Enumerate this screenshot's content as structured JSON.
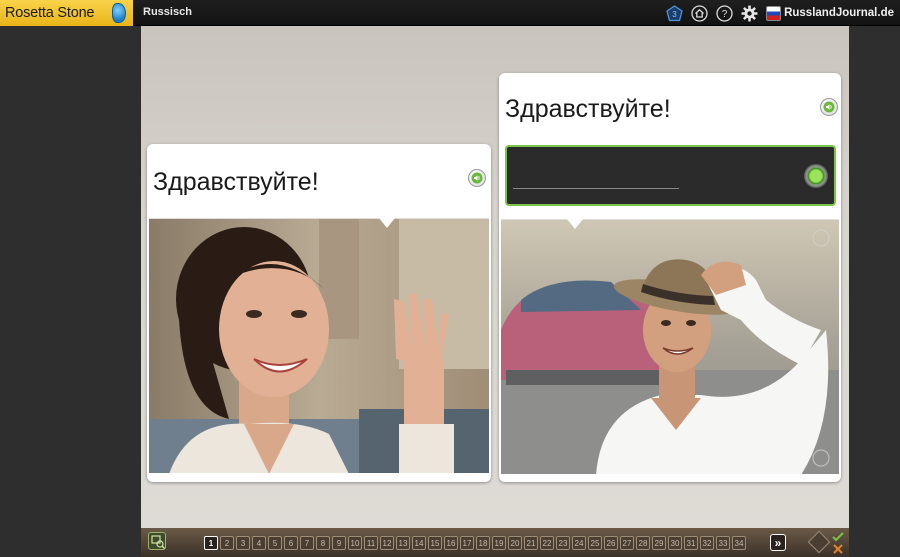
{
  "app": {
    "brand": "Rosetta Stone",
    "language": "Russisch",
    "site": "RusslandJournal.de"
  },
  "toolbar": {
    "icons": [
      "badge-icon",
      "home-icon",
      "help-icon",
      "settings-icon",
      "flag-icon"
    ]
  },
  "lesson": {
    "left_card": {
      "phrase": "Здравствуйте!"
    },
    "right_card": {
      "phrase": "Здравствуйте!",
      "answer_value": ""
    }
  },
  "pager": {
    "current": "1",
    "pages": [
      "1",
      "2",
      "3",
      "4",
      "5",
      "6",
      "7",
      "8",
      "9",
      "10",
      "11",
      "12",
      "13",
      "14",
      "15",
      "16",
      "17",
      "18",
      "19",
      "20",
      "21",
      "22",
      "23",
      "24",
      "25",
      "26",
      "27",
      "28",
      "29",
      "30",
      "31",
      "32",
      "33",
      "34"
    ],
    "next_label": "»"
  },
  "colors": {
    "brand_yellow": "#f4c531",
    "accent_green": "#7cc34a"
  }
}
